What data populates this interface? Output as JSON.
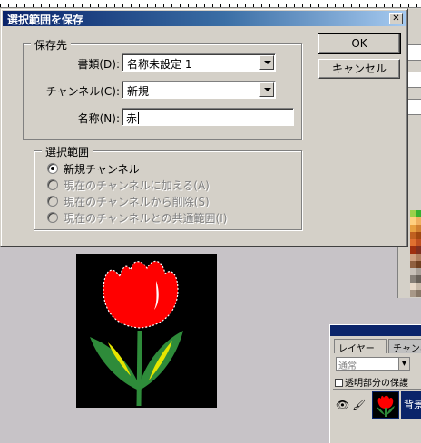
{
  "dialog": {
    "title": "選択範囲を保存",
    "close_glyph": "✕",
    "destination": {
      "legend": "保存先",
      "document_label": "書類(D):",
      "document_value": "名称未設定 1",
      "channel_label": "チャンネル(C):",
      "channel_value": "新規",
      "name_label": "名称(N):",
      "name_value": "赤"
    },
    "operation": {
      "legend": "選択範囲",
      "options": [
        {
          "label": "新規チャンネル",
          "selected": true,
          "enabled": true
        },
        {
          "label": "現在のチャンネルに加える(A)",
          "selected": false,
          "enabled": false
        },
        {
          "label": "現在のチャンネルから削除(S)",
          "selected": false,
          "enabled": false
        },
        {
          "label": "現在のチャンネルとの共通範囲(I)",
          "selected": false,
          "enabled": false
        }
      ]
    },
    "buttons": {
      "ok": "OK",
      "cancel": "キャンセル"
    }
  },
  "layers_panel": {
    "tabs": [
      "レイヤー",
      "チャンネル"
    ],
    "blend_mode": "通常",
    "lock_label": "透明部分の保護",
    "layer_name": "背景"
  },
  "icons": {
    "eye": "eye-icon",
    "brush": "brush-icon",
    "close": "close-icon",
    "dropdown": "chevron-down-icon"
  },
  "colors": {
    "titlebar_start": "#0a246a",
    "titlebar_end": "#a6caf0",
    "dialog_face": "#d4d0c8",
    "tulip_red": "#ff0000",
    "leaf_green": "#2e8b3a",
    "leaf_yellow": "#e6e600"
  }
}
